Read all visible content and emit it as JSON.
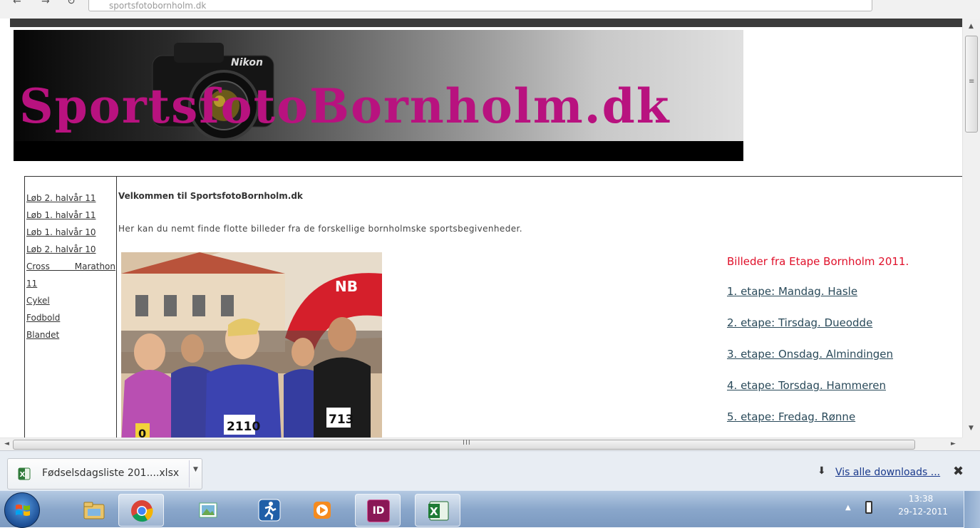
{
  "browser": {
    "url": "sportsfotobornholm.dk",
    "icons": {
      "back": "back-arrow-icon",
      "forward": "forward-arrow-icon",
      "reload": "reload-icon"
    }
  },
  "header": {
    "logo_text": "SportsfotoBornholm.dk"
  },
  "sidebar": {
    "items": [
      {
        "label": "Løb 2. halvår 11"
      },
      {
        "label": "Løb 1. halvår 11"
      },
      {
        "label": "Løb 1. halvår 10"
      },
      {
        "label": "Løb 2. halvår 10"
      },
      {
        "label": "Cross Marathon"
      },
      {
        "label": "11"
      },
      {
        "label": "Cykel"
      },
      {
        "label": "Fodbold"
      },
      {
        "label": "Blandet"
      }
    ]
  },
  "main": {
    "welcome": "Velkommen til SportsfotoBornholm.dk",
    "intro": "Her kan du nemt finde flotte billeder fra de forskellige bornholmske sportsbegivenheder.",
    "photo_bibs": [
      "0",
      "2110",
      "713"
    ],
    "etape_title": "Billeder fra Etape Bornholm 2011.",
    "etapes": [
      {
        "label": "1. etape: Mandag. Hasle"
      },
      {
        "label": "2. etape: Tirsdag. Dueodde"
      },
      {
        "label": "3. etape: Onsdag. Almindingen"
      },
      {
        "label": "4. etape: Torsdag. Hammeren"
      },
      {
        "label": "5. etape: Fredag. Rønne"
      }
    ]
  },
  "downloads": {
    "file_name": "Fødselsdagsliste 201....xlsx",
    "show_all": "Vis alle downloads ...",
    "close": "✖"
  },
  "taskbar": {
    "apps": [
      "windows-explorer",
      "chrome",
      "slideshow",
      "runner-app",
      "media-player",
      "indesign",
      "excel"
    ],
    "indesign_label": "ID",
    "time": "13:38",
    "date": "29-12-2011"
  },
  "colors": {
    "logo_magenta": "#b8127f",
    "etape_title_red": "#e0102a",
    "link_dark": "#2a4a5a",
    "taskbar_blue": "#8aa7cb"
  }
}
